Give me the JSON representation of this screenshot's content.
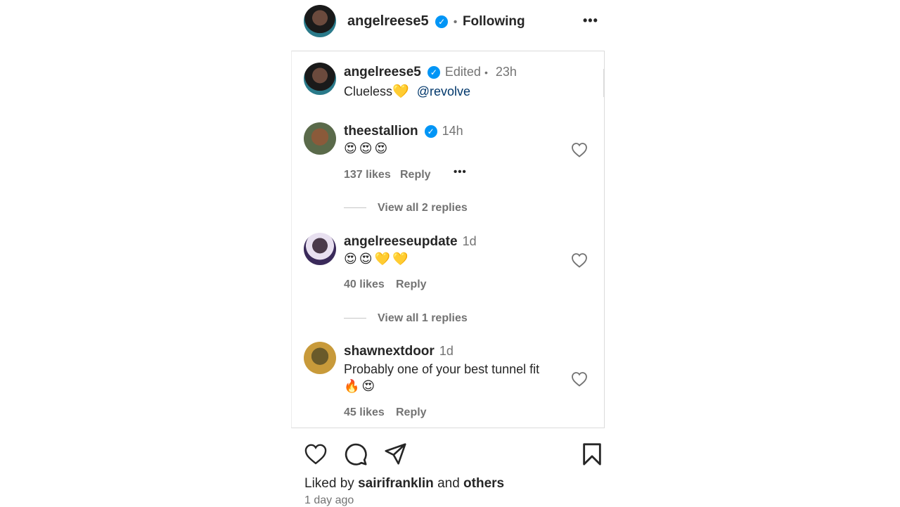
{
  "header": {
    "username": "angelreese5",
    "separator": "•",
    "follow_status": "Following",
    "more": "•••"
  },
  "post": {
    "username": "angelreese5",
    "edited": "Edited",
    "dot": "•",
    "time": "23h",
    "caption_text": "Clueless",
    "caption_emoji": "💛",
    "mention": "@revolve"
  },
  "comments": [
    {
      "username": "theestallion",
      "verified": true,
      "time": "14h",
      "text": "😍😍😍",
      "likes": "137 likes",
      "reply": "Reply",
      "more": "•••",
      "view_replies": "View all 2 replies"
    },
    {
      "username": "angelreeseupdate",
      "verified": false,
      "time": "1d",
      "text": "😍😍💛💛",
      "likes": "40 likes",
      "reply": "Reply",
      "view_replies": "View all 1 replies"
    },
    {
      "username": "shawnextdoor",
      "verified": false,
      "time": "1d",
      "text_line1": "Probably one of your best tunnel fit",
      "text_line2": "🔥😍",
      "likes": "45 likes",
      "reply": "Reply"
    }
  ],
  "footer": {
    "liked_by_prefix": "Liked by",
    "liked_by_user": "sairifranklin",
    "liked_by_and": "and",
    "liked_by_others": "others",
    "timestamp": "1 day ago"
  },
  "icons": {
    "verified": "verified-badge-icon",
    "like": "heart-icon",
    "comment": "comment-bubble-icon",
    "share": "paper-plane-icon",
    "save": "bookmark-icon"
  },
  "colors": {
    "verified": "#0095f6",
    "mention": "#00376b",
    "muted": "#737373",
    "text": "#262626"
  }
}
